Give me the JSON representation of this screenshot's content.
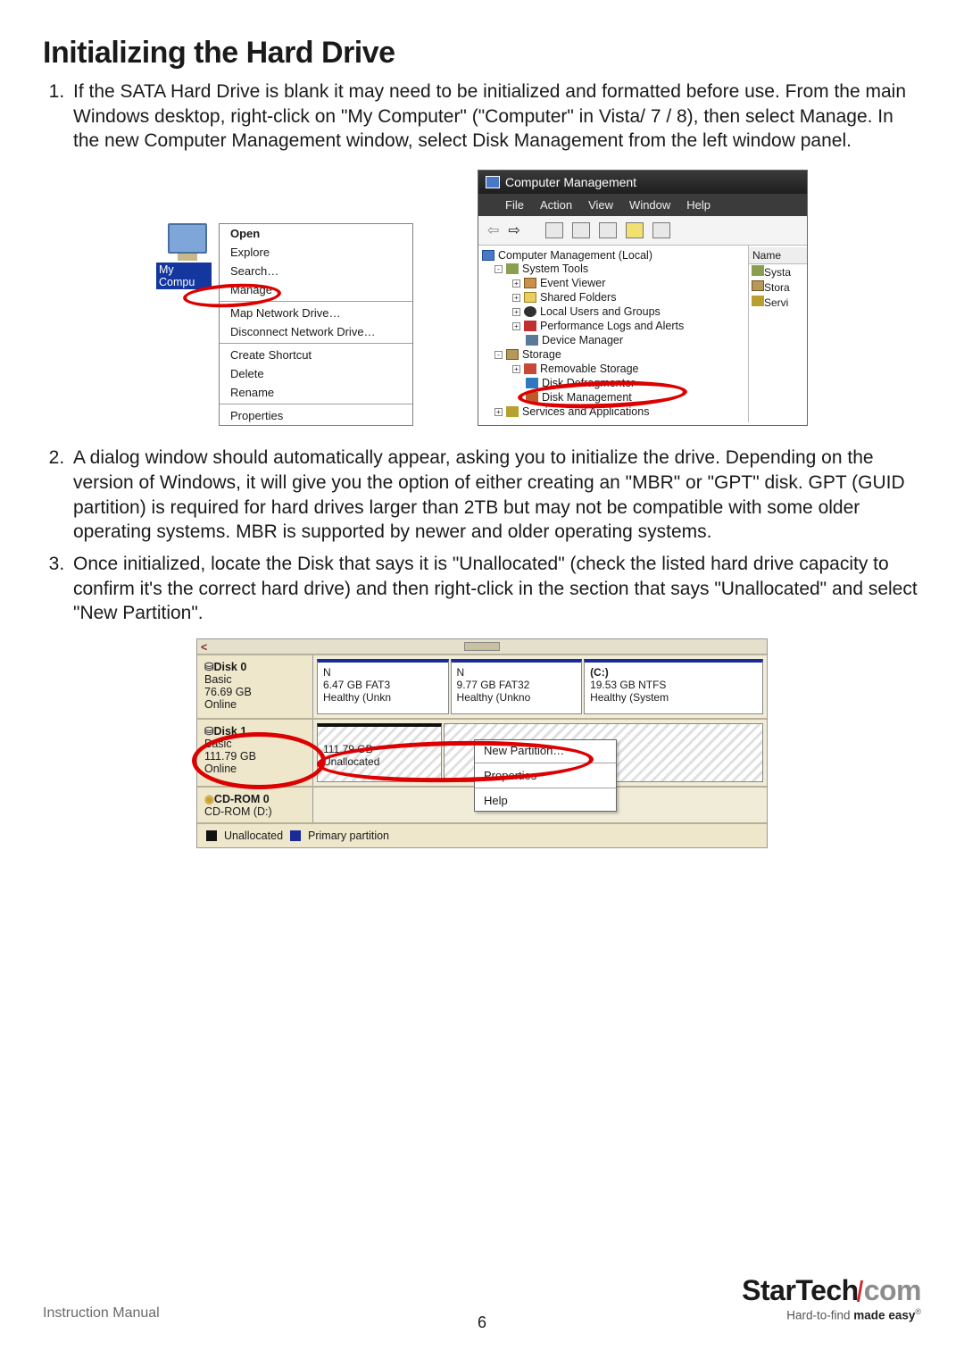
{
  "heading": "Initializing the Hard Drive",
  "steps": {
    "s1": "If the SATA Hard Drive is blank it may need to be initialized and formatted before use. From the main Windows desktop, right-click on \"My Computer\" (\"Computer\" in Vista/ 7 / 8), then select Manage. In the new Computer Management window, select Disk Management from the left window panel.",
    "s2": "A dialog window should automatically appear, asking you to initialize the drive. Depending on the version of Windows, it will give you the option of either creating an \"MBR\" or \"GPT\" disk. GPT (GUID partition) is required for hard drives larger than 2TB but may not be compatible with some older operating systems. MBR is supported by newer and older operating systems.",
    "s3": "Once initialized, locate the Disk that says it is \"Unallocated\" (check the listed hard drive capacity to confirm it's the correct hard drive) and then right-click in the section that says \"Unallocated\" and select \"New Partition\"."
  },
  "fig1": {
    "icon_label": "My Compu",
    "menu": {
      "open": "Open",
      "explore": "Explore",
      "search": "Search…",
      "manage": "Manage",
      "map": "Map Network Drive…",
      "disconnect": "Disconnect Network Drive…",
      "shortcut": "Create Shortcut",
      "delete": "Delete",
      "rename": "Rename",
      "properties": "Properties"
    }
  },
  "fig2": {
    "title": "Computer Management",
    "menubar": {
      "file": "File",
      "action": "Action",
      "view": "View",
      "window": "Window",
      "help": "Help"
    },
    "tree": {
      "root": "Computer Management (Local)",
      "system_tools": "System Tools",
      "event": "Event Viewer",
      "shared": "Shared Folders",
      "users": "Local Users and Groups",
      "perf": "Performance Logs and Alerts",
      "device": "Device Manager",
      "storage": "Storage",
      "removable": "Removable Storage",
      "defrag": "Disk Defragmenter",
      "diskmgmt": "Disk Management",
      "services": "Services and Applications"
    },
    "col2": {
      "hdr": "Name",
      "r1": "Systa",
      "r2": "Stora",
      "r3": "Servi"
    }
  },
  "fig3": {
    "disk0": {
      "name": "Disk 0",
      "type": "Basic",
      "size": "76.69 GB",
      "status": "Online"
    },
    "d0v1": {
      "l1": "N",
      "l2": "6.47 GB FAT3",
      "l3": "Healthy (Unkn"
    },
    "d0v2": {
      "l1": "N",
      "l2": "9.77 GB FAT32",
      "l3": "Healthy (Unkno"
    },
    "d0v3": {
      "l1": "(C:)",
      "l2": "19.53 GB NTFS",
      "l3": "Healthy (System"
    },
    "disk1": {
      "name": "Disk 1",
      "type": "Basic",
      "size": "111.79 GB",
      "status": "Online"
    },
    "d1v1": {
      "l1": "111.79 GB",
      "l2": "Unallocated"
    },
    "cdrom": {
      "name": "CD-ROM 0",
      "sub": "CD-ROM (D:)"
    },
    "legend": {
      "a": "Unallocated",
      "b": "Primary partition"
    },
    "ctx": {
      "newpart": "New Partition…",
      "props": "Properties",
      "help": "Help"
    }
  },
  "footer": {
    "left": "Instruction Manual",
    "page": "6",
    "brand1": "StarTech",
    "brand2": "com",
    "tag_a": "Hard-to-find ",
    "tag_b": "made easy"
  }
}
